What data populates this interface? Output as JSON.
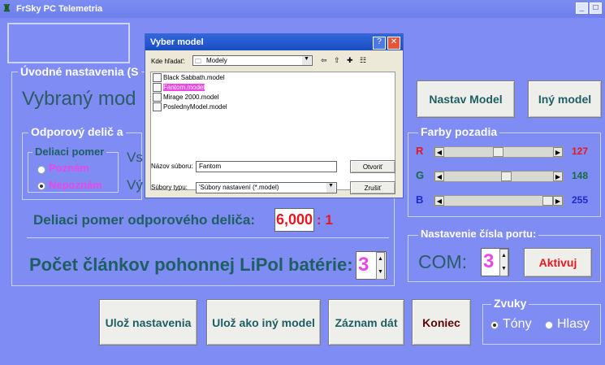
{
  "window": {
    "title": "FrSky PC Telemetria"
  },
  "main": {
    "initial_section": "Úvodné nastavenia (S",
    "selected_model_label": "Vybraný mod",
    "resistor_section": "Odporový delič a",
    "divider_ratio_legend": "Deliaci pomer",
    "option_known": "Poznám",
    "option_unknown": "Nepoznám",
    "vs_label": "Vs",
    "vy_label": "Vý",
    "resistor_ratio_label": "Deliaci pomer odporového deliča:",
    "resistor_ratio_value": "6,000",
    "ratio_suffix": ": 1",
    "cells_label": "Počet článkov pohonnej LiPol batérie:",
    "cells_value": "3"
  },
  "buttons": {
    "set_model": "Nastav Model",
    "other_model": "Iný model",
    "save_settings": "Ulož nastavenia",
    "save_as_other_model": "Ulož ako iný model",
    "record_data": "Záznam dát",
    "exit": "Koniec",
    "activate": "Aktivuj"
  },
  "colors_panel": {
    "title": "Farby pozadia",
    "rows": [
      {
        "label": "R",
        "value": "127",
        "level": 127,
        "color": "#e8171f"
      },
      {
        "label": "G",
        "value": "148",
        "level": 148,
        "color": "#146c41"
      },
      {
        "label": "B",
        "value": "255",
        "level": 255,
        "color": "#1e2ac9"
      }
    ]
  },
  "port_panel": {
    "title": "Nastavenie čísla portu:",
    "com_label": "COM:",
    "com_value": "3"
  },
  "sound_panel": {
    "title": "Zvuky",
    "tones": "Tóny",
    "voice": "Hlasy"
  },
  "dialog": {
    "title": "Vyber model",
    "look_in_label": "Kde hľadať:",
    "look_in_value": "Modely",
    "files": [
      {
        "name": "Black Sabbath.model",
        "selected": false
      },
      {
        "name": "Fantom.model",
        "selected": true
      },
      {
        "name": "Mirage 2000.model",
        "selected": false
      },
      {
        "name": "PoslednyModel.model",
        "selected": false
      }
    ],
    "file_name_label": "Názov súboru:",
    "file_name_value": "Fantom",
    "file_type_label": "Súbory typu:",
    "file_type_value": "'Súbory nastavení (*.model)",
    "open_button": "Otvoriť",
    "cancel_button": "Zrušiť"
  }
}
